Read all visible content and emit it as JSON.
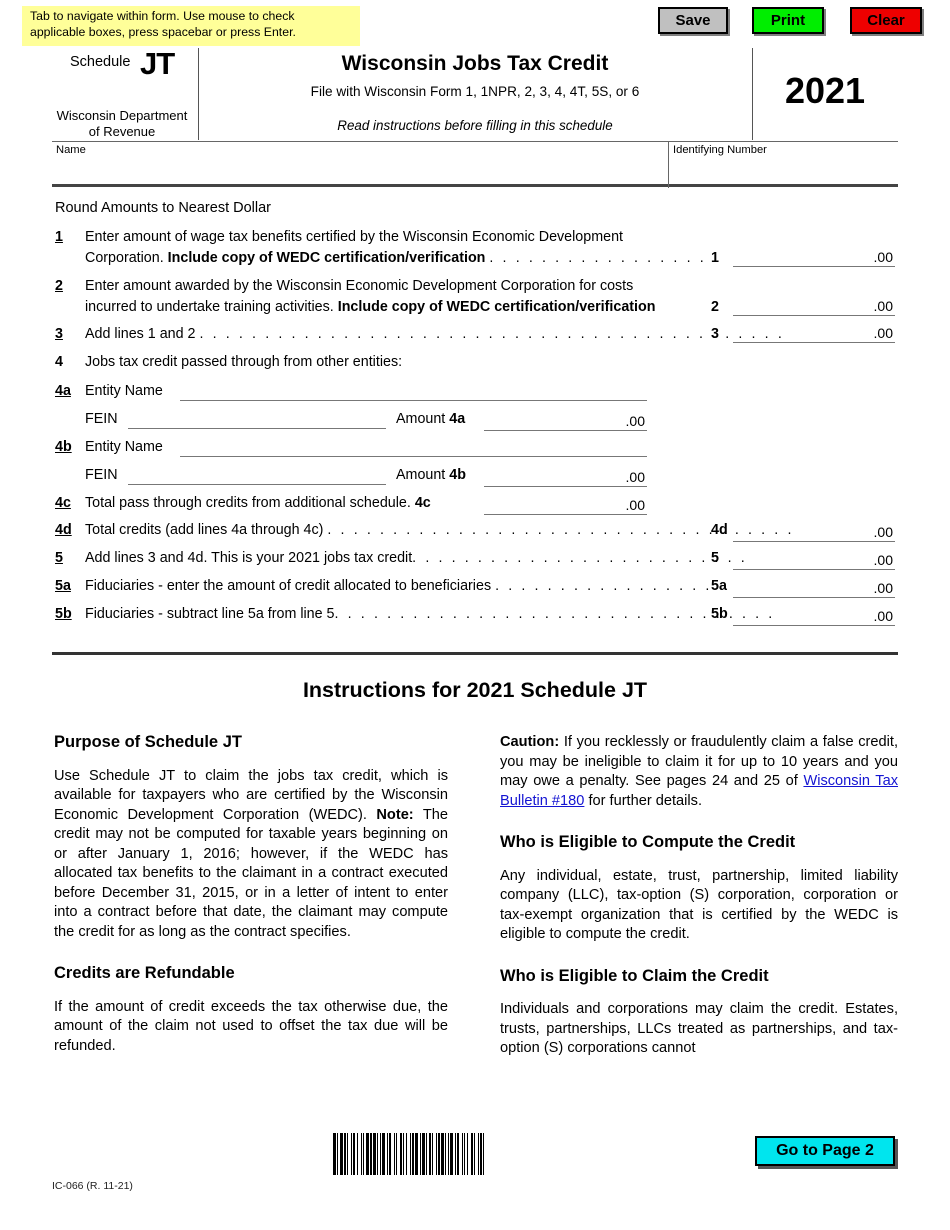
{
  "tip": {
    "line1": "Tab to navigate within form. Use mouse to check",
    "line2": "applicable boxes, press spacebar or press Enter."
  },
  "toolbar": {
    "save_label": "Save",
    "print_label": "Print",
    "clear_label": "Clear",
    "save_color": "#c0c0c0",
    "print_color": "#00ee00",
    "clear_color": "#ee0000"
  },
  "header": {
    "schedule_label": "Schedule",
    "schedule_code": "JT",
    "department_line1": "Wisconsin Department",
    "department_line2": "of Revenue",
    "title": "Wisconsin Jobs Tax Credit",
    "subtitle": "File with Wisconsin Form 1, 1NPR, 2, 3, 4, 4T, 5S, or 6",
    "read_instructions": "Read instructions before filling in this schedule",
    "year": "2021"
  },
  "identity": {
    "name_label": "Name",
    "name_value": "",
    "id_label": "Identifying Number",
    "id_value": ""
  },
  "form": {
    "round_note": "Round Amounts to Nearest Dollar",
    "cents": ".00",
    "line1": {
      "num": "1",
      "text_a": "Enter amount of wage tax benefits certified by the Wisconsin Economic Development",
      "text_b": "Corporation. ",
      "text_b_bold": "Include copy of WEDC certification/verification",
      "leader": ". . . . . . . . . . . . . . . . . .",
      "ref": "1",
      "value": ""
    },
    "line2": {
      "num": "2",
      "text_a": "Enter amount awarded by the Wisconsin Economic Development Corporation for costs",
      "text_b": "incurred to undertake training activities. ",
      "text_b_bold": "Include copy of WEDC certification/verification",
      "ref": "2",
      "value": ""
    },
    "line3": {
      "num": "3",
      "text": "Add lines 1 and 2",
      "leader": ". . . . . . . . . . . . . . . . . . . . . . . . . . . . . . . . . . . . . . . . . . . . .",
      "ref": "3",
      "value": ""
    },
    "line4": {
      "num": "4",
      "text": "Jobs tax credit passed through from other entities:"
    },
    "line4a": {
      "num": "4a",
      "entity_label": "Entity Name",
      "entity_value": "",
      "fein_label": "FEIN",
      "fein_value": "",
      "amount_label": "Amount",
      "ref": "4a",
      "value": ""
    },
    "line4b": {
      "num": "4b",
      "entity_label": "Entity Name",
      "entity_value": "",
      "fein_label": "FEIN",
      "fein_value": "",
      "amount_label": "Amount",
      "ref": "4b",
      "value": ""
    },
    "line4c": {
      "num": "4c",
      "text": "Total pass through credits from additional schedule.",
      "ref": "4c",
      "value": ""
    },
    "line4d": {
      "num": "4d",
      "text": "Total credits (add lines 4a through 4c)",
      "leader": ". . . . . . . . . . . . . . . . . . . . . . . . . . . . . . . . . . . .",
      "ref": "4d",
      "value": ""
    },
    "line5": {
      "num": "5",
      "text": "Add lines 3 and 4d.  This is your 2021 jobs tax credit",
      "leader": ". . . . . . . . . . . . . . . . . . . . . . . . . .",
      "ref": "5",
      "value": ""
    },
    "line5a": {
      "num": "5a",
      "text": "Fiduciaries - enter the amount of credit allocated to beneficiaries",
      "leader": ". . . . . . . . . . . . . . . . .",
      "ref": "5a",
      "value": ""
    },
    "line5b": {
      "num": "5b",
      "text": "Fiduciaries - subtract line 5a from line 5",
      "leader": ". . . . . . . . . . . . . . . . . . . . . . . . . . . . . . . . . .",
      "ref": "5b",
      "value": ""
    }
  },
  "instructions": {
    "title": "Instructions for 2021 Schedule JT",
    "left": {
      "h1": "Purpose of Schedule JT",
      "p1_a": "Use Schedule JT to claim the jobs tax credit, which is available for taxpayers who are certified by the Wisconsin Economic Development Corporation (WEDC). ",
      "p1_note": "Note:",
      "p1_b": "  The credit may not be computed for taxable years beginning on or after January 1, 2016; however, if the WEDC has allocated tax benefits to the claimant in a contract executed before December 31, 2015, or in a letter of intent to enter into a contract before that date, the claimant may compute the credit for as long as the contract specifies.",
      "h2": "Credits are Refundable",
      "p2": "If the amount of credit exceeds the tax otherwise due, the amount of the claim not used to offset the tax due will be refunded."
    },
    "right": {
      "caution_label": "Caution:",
      "caution_a": "  If you recklessly or fraudulently claim a false credit, you may be ineligible to claim it for up to 10 years and you may owe a penalty. See pages 24 and 25 of ",
      "caution_link": "Wisconsin Tax Bulletin #180",
      "caution_b": " for further details.",
      "h1": "Who is Eligible to Compute the Credit",
      "p1": "Any individual, estate, trust, partnership, limited liability company (LLC), tax-option (S) corporation, corporation or tax-exempt organization that is certified by the WEDC is eligible to compute the credit.",
      "h2": "Who is Eligible to Claim the Credit",
      "p2": "Individuals and corporations may claim the credit. Estates, trusts, partnerships, LLCs treated as partnerships, and tax-option (S) corporations cannot"
    }
  },
  "footer": {
    "form_code": "IC-066 (R. 11-21)",
    "go_to_page_label": "Go to Page 2",
    "go_to_page_color": "#00e5ee"
  }
}
